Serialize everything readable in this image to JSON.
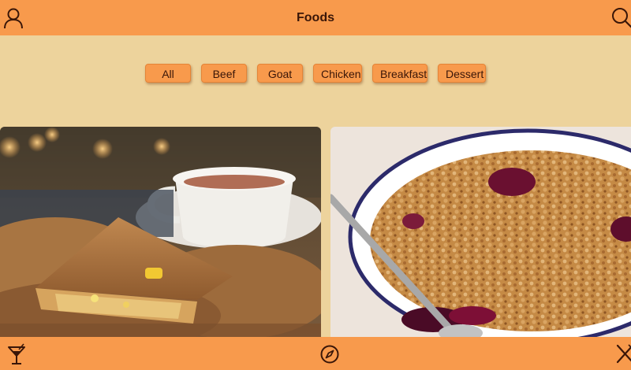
{
  "header": {
    "title": "Foods",
    "left_icon": "profile-icon",
    "right_icon": "search-icon"
  },
  "filters": [
    {
      "label": "All",
      "selected": true
    },
    {
      "label": "Beef"
    },
    {
      "label": "Goat"
    },
    {
      "label": "Chicken"
    },
    {
      "label": "Breakfast"
    },
    {
      "label": "Dessert"
    }
  ],
  "cards": [
    {
      "image": "stuffed-pancake-with-tea-photo"
    },
    {
      "image": "berry-crumble-dish-photo"
    }
  ],
  "tabbar": {
    "items": [
      {
        "icon": "cocktail-icon"
      },
      {
        "icon": "compass-icon"
      },
      {
        "icon": "utensils-icon"
      }
    ]
  },
  "colors": {
    "accent": "#F89A4C",
    "background": "#EDD39C",
    "text": "#3A1608"
  }
}
